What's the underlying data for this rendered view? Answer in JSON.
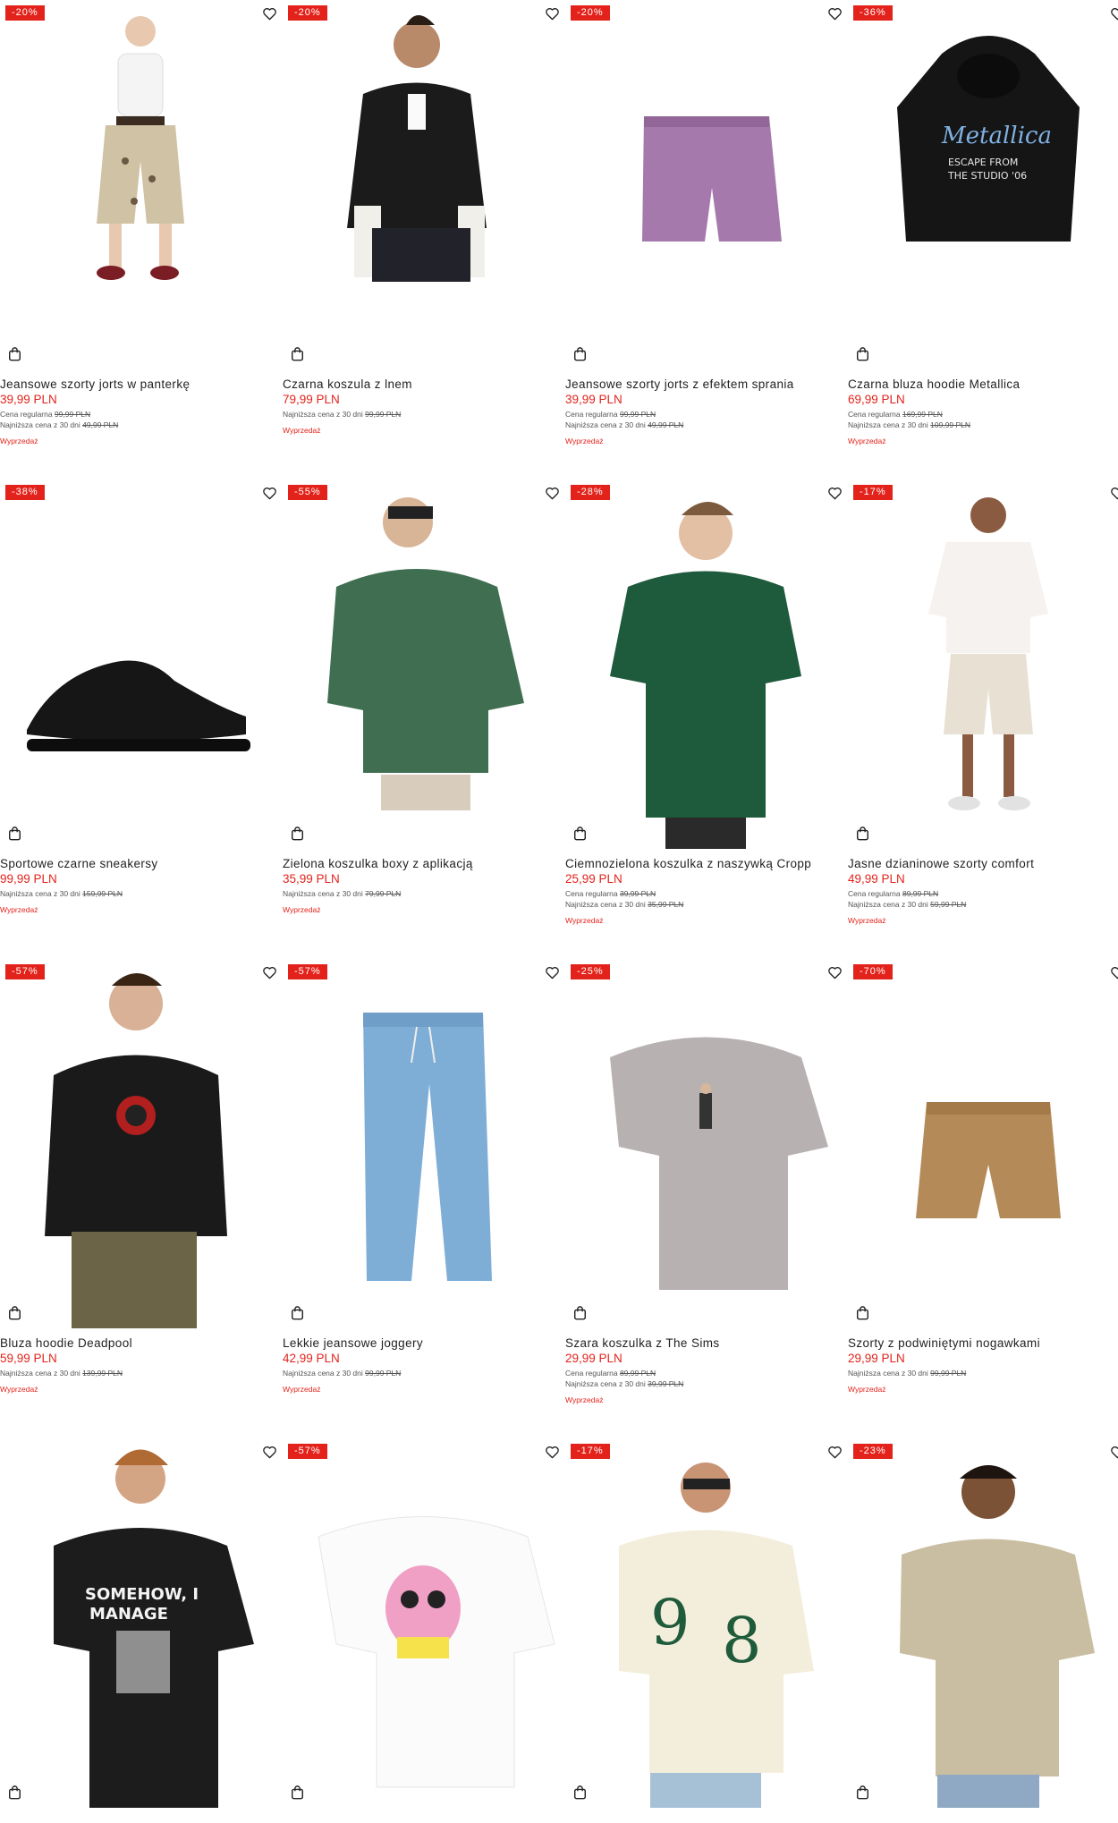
{
  "icons": {
    "wishlist": "heart-icon",
    "cart": "shopping-bag-icon"
  },
  "colors": {
    "accent": "#e3231b",
    "text": "#1f1f1f"
  },
  "products": [
    {
      "badge": "-20%",
      "name": "Jeansowe szorty jorts w panterkę",
      "price": "39,99 PLN",
      "regular_label": "Cena regularna",
      "regular_price": "99,99 PLN",
      "lowest_label": "Najniższa cena z 30 dni",
      "lowest_price": "49,99 PLN",
      "sale_label": "Wyprzedaż"
    },
    {
      "badge": "-20%",
      "name": "Czarna koszula z lnem",
      "price": "79,99 PLN",
      "lowest_label": "Najniższa cena z 30 dni",
      "lowest_price": "99,99 PLN",
      "sale_label": "Wyprzedaż"
    },
    {
      "badge": "-20%",
      "name": "Jeansowe szorty jorts z efektem sprania",
      "price": "39,99 PLN",
      "regular_label": "Cena regularna",
      "regular_price": "99,99 PLN",
      "lowest_label": "Najniższa cena z 30 dni",
      "lowest_price": "49,99 PLN",
      "sale_label": "Wyprzedaż"
    },
    {
      "badge": "-36%",
      "name": "Czarna bluza hoodie Metallica",
      "price": "69,99 PLN",
      "regular_label": "Cena regularna",
      "regular_price": "169,99 PLN",
      "lowest_label": "Najniższa cena z 30 dni",
      "lowest_price": "109,99 PLN",
      "sale_label": "Wyprzedaż"
    },
    {
      "badge": "-38%",
      "name": "Sportowe czarne sneakersy",
      "price": "99,99 PLN",
      "lowest_label": "Najniższa cena z 30 dni",
      "lowest_price": "159,99 PLN",
      "sale_label": "Wyprzedaż"
    },
    {
      "badge": "-55%",
      "name": "Zielona koszulka boxy z aplikacją",
      "price": "35,99 PLN",
      "lowest_label": "Najniższa cena z 30 dni",
      "lowest_price": "79,99 PLN",
      "sale_label": "Wyprzedaż"
    },
    {
      "badge": "-28%",
      "name": "Ciemnozielona koszulka z naszywką Cropp",
      "price": "25,99 PLN",
      "regular_label": "Cena regularna",
      "regular_price": "39,99 PLN",
      "lowest_label": "Najniższa cena z 30 dni",
      "lowest_price": "35,99 PLN",
      "sale_label": "Wyprzedaż"
    },
    {
      "badge": "-17%",
      "name": "Jasne dzianinowe szorty comfort",
      "price": "49,99 PLN",
      "regular_label": "Cena regularna",
      "regular_price": "89,99 PLN",
      "lowest_label": "Najniższa cena z 30 dni",
      "lowest_price": "59,99 PLN",
      "sale_label": "Wyprzedaż"
    },
    {
      "badge": "-57%",
      "name": "Bluza hoodie Deadpool",
      "price": "59,99 PLN",
      "lowest_label": "Najniższa cena z 30 dni",
      "lowest_price": "139,99 PLN",
      "sale_label": "Wyprzedaż"
    },
    {
      "badge": "-57%",
      "name": "Lekkie jeansowe joggery",
      "price": "42,99 PLN",
      "lowest_label": "Najniższa cena z 30 dni",
      "lowest_price": "99,99 PLN",
      "sale_label": "Wyprzedaż"
    },
    {
      "badge": "-25%",
      "name": "Szara koszulka z The Sims",
      "price": "29,99 PLN",
      "regular_label": "Cena regularna",
      "regular_price": "89,99 PLN",
      "lowest_label": "Najniższa cena z 30 dni",
      "lowest_price": "39,99 PLN",
      "sale_label": "Wyprzedaż"
    },
    {
      "badge": "-70%",
      "name": "Szorty z podwiniętymi nogawkami",
      "price": "29,99 PLN",
      "lowest_label": "Najniższa cena z 30 dni",
      "lowest_price": "99,99 PLN",
      "sale_label": "Wyprzedaż"
    },
    {
      "badge": "",
      "name": "",
      "price": ""
    },
    {
      "badge": "-57%",
      "name": "",
      "price": ""
    },
    {
      "badge": "-17%",
      "name": "",
      "price": ""
    },
    {
      "badge": "-23%",
      "name": "",
      "price": ""
    }
  ]
}
